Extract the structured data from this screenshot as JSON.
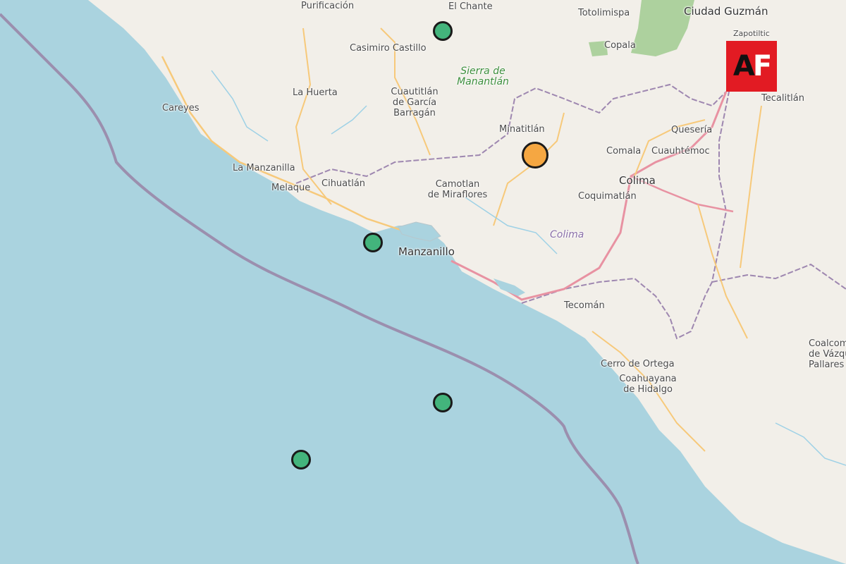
{
  "map": {
    "colors": {
      "land": "#f2efe9",
      "sea": "#aad3df",
      "trench": "#9b8fae",
      "border": "#9e87b0",
      "motorway": "#e892a2",
      "road": "#f7c97a",
      "river": "#9ed1e6",
      "forest": "#add19e",
      "minor": "#ffffff"
    },
    "labels": {
      "purificacion": "Purificación",
      "el_chante": "El Chante",
      "totolimispa": "Totolimispa",
      "ciudad_guzman": "Ciudad Guzmán",
      "zapotiltic": "Zapotiltic",
      "casimiro_castillo": "Casimiro Castillo",
      "copala": "Copala",
      "sierra_l1": "Sierra de",
      "sierra_l2": "Manantlán",
      "la_huerta": "La Huerta",
      "cuautitlan_l1": "Cuautitlán",
      "cuautitlan_l2": "de García",
      "cuautitlan_l3": "Barragán",
      "careyes": "Careyes",
      "tecalitlan": "Tecalitlán",
      "minatitlan": "Minatitlán",
      "queseria": "Quesería",
      "comala": "Comala",
      "cuauhtemoc": "Cuauhtémoc",
      "la_manzanilla": "La Manzanilla",
      "colima_city": "Colima",
      "melaque": "Melaque",
      "cihuatlan": "Cihuatlán",
      "camotlan_l1": "Camotlan",
      "camotlan_l2": "de Miraflores",
      "coquimatlan": "Coquimatlán",
      "colima_state": "Colima",
      "manzanillo": "Manzanillo",
      "tecoman": "Tecomán",
      "coalcoman_l1": "Coalcom",
      "coalcoman_l2": "de Vázqu",
      "coalcoman_l3": "Pallares",
      "cerro_ortega": "Cerro de Ortega",
      "coahuayana_l1": "Coahuayana",
      "coahuayana_l2": "de Hidalgo"
    },
    "markers": [
      {
        "name": "epicenter-marker-el-chante",
        "color": "#43b47c",
        "size": "small"
      },
      {
        "name": "epicenter-marker-minatitlan",
        "color": "#f5a742",
        "size": "large"
      },
      {
        "name": "epicenter-marker-manzanillo-coast",
        "color": "#43b47c",
        "size": "small"
      },
      {
        "name": "epicenter-marker-offshore-east",
        "color": "#43b47c",
        "size": "small"
      },
      {
        "name": "epicenter-marker-offshore-west",
        "color": "#43b47c",
        "size": "small"
      }
    ]
  },
  "logo": {
    "letter_a": "A",
    "letter_f": "F",
    "bg_color": "#e21b23"
  }
}
